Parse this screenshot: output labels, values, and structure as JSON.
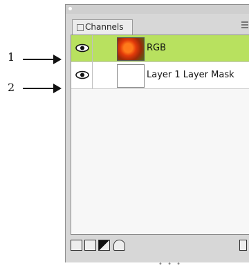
{
  "callouts": [
    "1",
    "2"
  ],
  "panel": {
    "tab_label": "Channels",
    "rows": [
      {
        "name": "RGB",
        "thumbnail": "rgb-image-thumbnail",
        "selected": true,
        "visible": true
      },
      {
        "name": "Layer 1 Layer Mask",
        "thumbnail": "mask-thumbnail",
        "selected": false,
        "visible": true
      }
    ],
    "footer_grip": "• • •",
    "colors": {
      "selected_row": "#b8e15f",
      "panel_bg": "#d7d7d7"
    }
  }
}
